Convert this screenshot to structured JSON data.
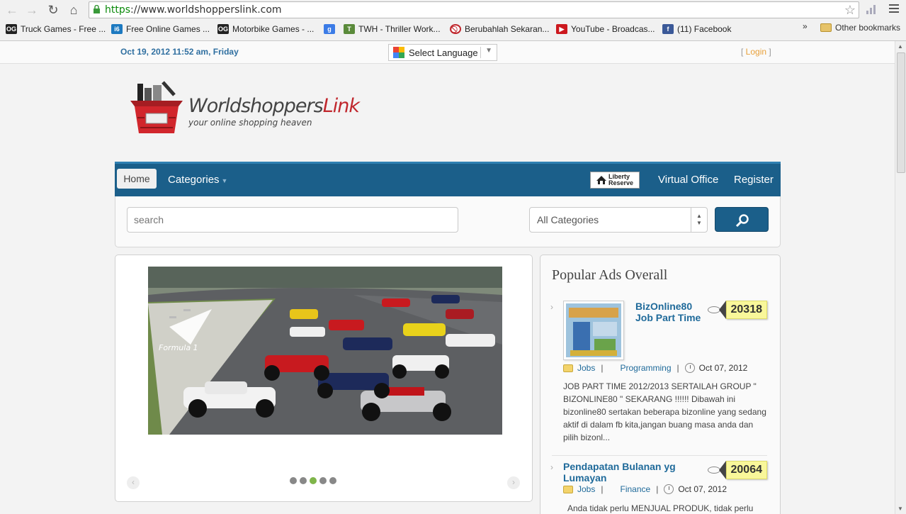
{
  "browser": {
    "url_scheme": "https",
    "url_rest": "://www.worldshopperslink.com",
    "bookmarks": [
      {
        "label": "Truck Games - Free ...",
        "icon": "ogc-icon",
        "color": "#222"
      },
      {
        "label": "Free Online Games ...",
        "icon": "i6-icon",
        "color": "#1c79c0"
      },
      {
        "label": "Motorbike Games - ...",
        "icon": "ogc-icon",
        "color": "#222"
      },
      {
        "label": "",
        "icon": "google-icon",
        "color": "#3b7be6"
      },
      {
        "label": "TWH - Thriller Work...",
        "icon": "twh-icon",
        "color": "#5a8a3a"
      },
      {
        "label": "Berubahlah Sekaran...",
        "icon": "no-icon",
        "color": "#c0272d"
      },
      {
        "label": "YouTube - Broadcas...",
        "icon": "youtube-icon",
        "color": "#cc181e"
      },
      {
        "label": "(11) Facebook",
        "icon": "facebook-icon",
        "color": "#3b5998"
      }
    ],
    "more": "»",
    "other_bookmarks": "Other bookmarks"
  },
  "header": {
    "date": "Oct 19, 2012 11:52 am, Friday",
    "language": "Select Language",
    "login_open": "[ ",
    "login": "Login",
    "login_close": " ]"
  },
  "logo": {
    "name_main": "Worldshoppers",
    "name_accent": "Link",
    "tagline": "your online shopping heaven"
  },
  "nav": {
    "home": "Home",
    "categories": "Categories",
    "liberty_line1": "Liberty",
    "liberty_line2": "Reserve",
    "virtual_office": "Virtual Office",
    "register": "Register"
  },
  "search": {
    "placeholder": "search",
    "category": "All Categories"
  },
  "slider": {
    "slide_label": "Formula 1",
    "dots": 5,
    "active_dot": 3
  },
  "popular": {
    "title": "Popular Ads Overall",
    "ads": [
      {
        "title": "BizOnline80 Job Part Time",
        "count": "20318",
        "category": "Jobs",
        "subcategory": "Programming",
        "date": "Oct 07, 2012",
        "description": "JOB PART TIME 2012/2013 SERTAILAH GROUP \" BIZONLINE80 \" SEKARANG !!!!!! Dibawah ini bizonline80 sertakan beberapa bizonline yang sedang aktif di dalam fb kita,jangan buang masa anda dan pilih bizonl..."
      },
      {
        "title": "Pendapatan Bulanan yg Lumayan",
        "count": "20064",
        "category": "Jobs",
        "subcategory": "Finance",
        "date": "Oct 07, 2012",
        "description": "Anda tidak perlu MENJUAL PRODUK, tidak perlu"
      }
    ]
  },
  "colors": {
    "nav_blue": "#1b5f8a",
    "link_blue": "#1f6a9a",
    "login_orange": "#e8a03a",
    "tag_yellow": "#f9f79a"
  }
}
